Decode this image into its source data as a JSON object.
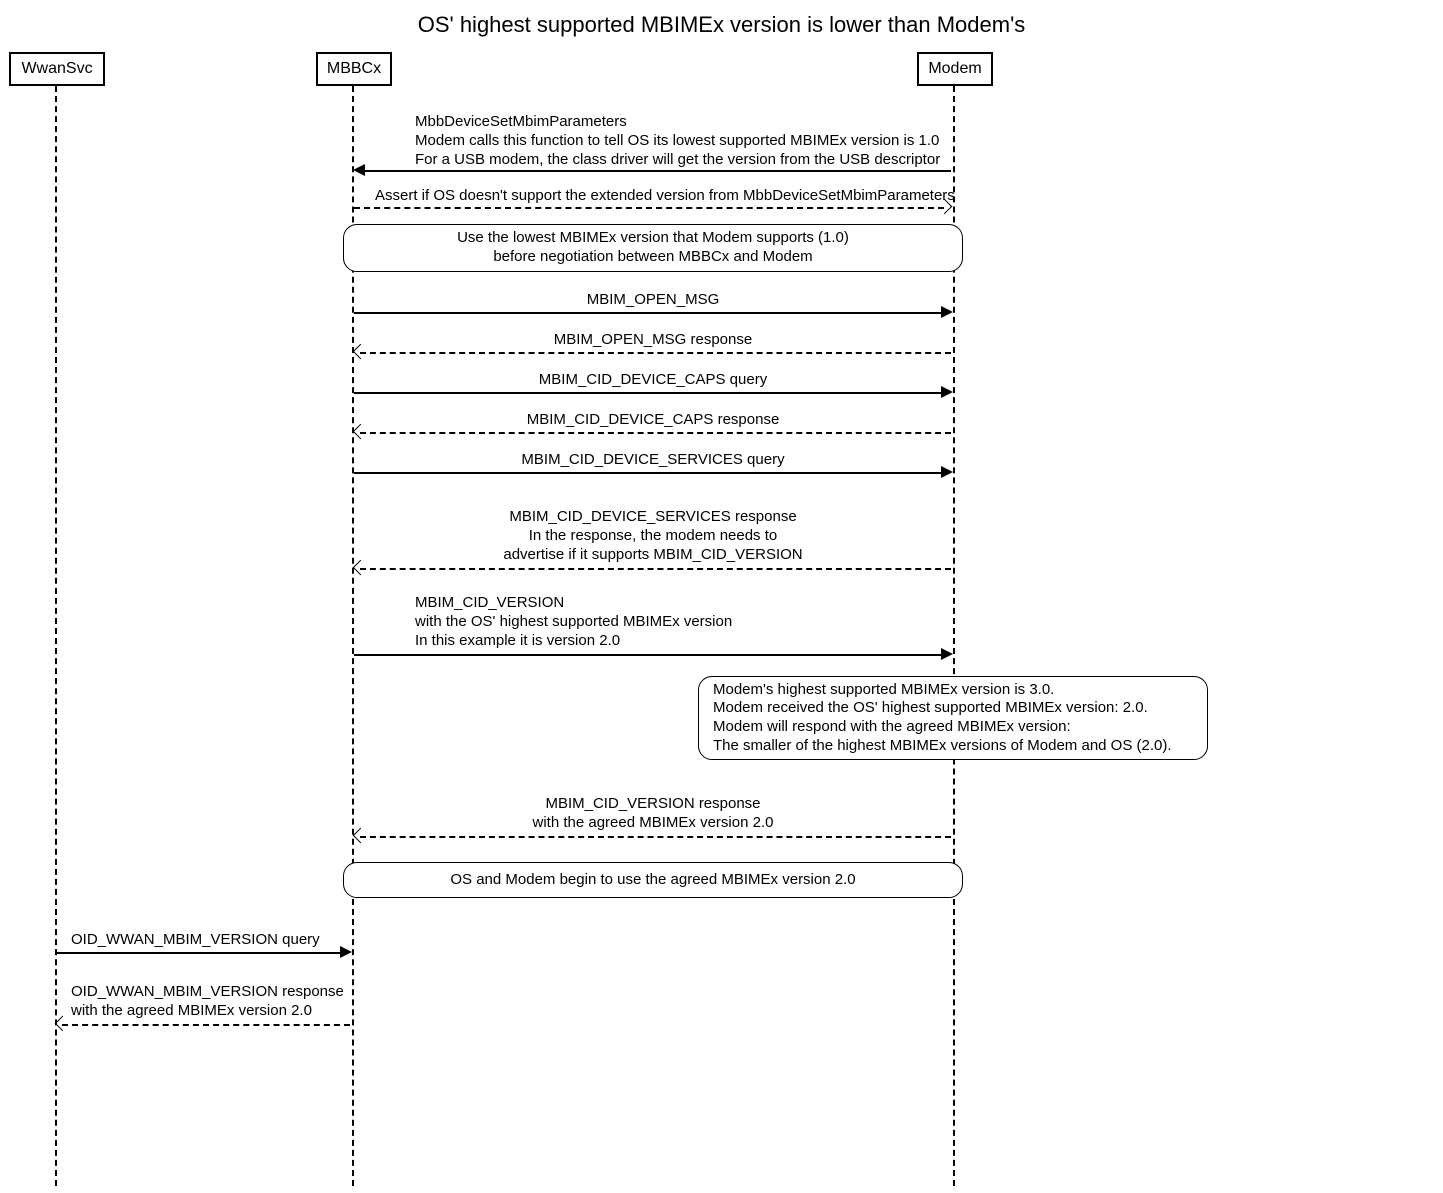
{
  "title": "OS' highest supported MBIMEx version is lower than Modem's",
  "actors": {
    "wwansvc": "WwanSvc",
    "mbbcx": "MBBCx",
    "modem": "Modem"
  },
  "messages": {
    "m1": "MbbDeviceSetMbimParameters\nModem calls this function to tell OS its lowest supported MBIMEx version is 1.0\nFor a USB modem, the class driver will get the version from the USB descriptor",
    "m2": "Assert if OS doesn't support the extended version from MbbDeviceSetMbimParameters",
    "note1": "Use the lowest MBIMEx version that Modem supports (1.0)\nbefore negotiation between MBBCx and Modem",
    "m3": "MBIM_OPEN_MSG",
    "m4": "MBIM_OPEN_MSG response",
    "m5": "MBIM_CID_DEVICE_CAPS query",
    "m6": "MBIM_CID_DEVICE_CAPS response",
    "m7": "MBIM_CID_DEVICE_SERVICES query",
    "m8": "MBIM_CID_DEVICE_SERVICES response\nIn the response, the modem needs to\nadvertise if it supports MBIM_CID_VERSION",
    "m9": "MBIM_CID_VERSION\nwith the OS' highest supported MBIMEx version\nIn this example it is version 2.0",
    "note2": "Modem's highest supported MBIMEx version is 3.0.\nModem received the OS' highest supported MBIMEx version: 2.0.\nModem will respond with the agreed MBIMEx version:\nThe smaller of the highest MBIMEx versions of Modem and OS (2.0).",
    "m10": "MBIM_CID_VERSION response\nwith the agreed MBIMEx version 2.0",
    "note3": "OS and Modem begin to use the agreed MBIMEx version 2.0",
    "m11": "OID_WWAN_MBIM_VERSION query",
    "m12": "OID_WWAN_MBIM_VERSION response\nwith the agreed MBIMEx version 2.0"
  }
}
